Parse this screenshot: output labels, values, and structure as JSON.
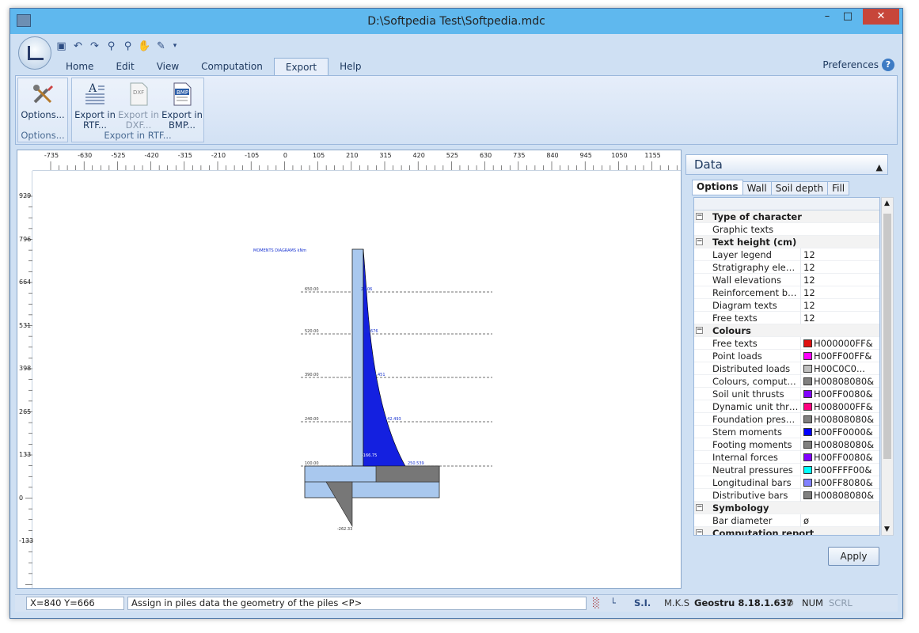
{
  "window": {
    "title": "D:\\Softpedia Test\\Softpedia.mdc",
    "min": "–",
    "max": "□",
    "close": "✕"
  },
  "menu": {
    "tabs": [
      "Home",
      "Edit",
      "View",
      "Computation",
      "Export",
      "Help"
    ],
    "active": "Export",
    "preferences": "Preferences",
    "help_icon": "?"
  },
  "ribbon": {
    "options_button": "Options...",
    "options_group": "Options...",
    "export_rtf": "Export in RTF...",
    "export_dxf": "Export in DXF...",
    "export_bmp": "Export in BMP...",
    "export_group": "Export in RTF..."
  },
  "ruler": {
    "h_ticks": [
      "-735",
      "-630",
      "-525",
      "-420",
      "-315",
      "-210",
      "-105",
      "0",
      "105",
      "210",
      "315",
      "420",
      "525",
      "630",
      "735",
      "840",
      "945",
      "1050",
      "1155"
    ],
    "v_ticks": [
      "929",
      "796",
      "664",
      "531",
      "398",
      "265",
      "133",
      "0",
      "-133"
    ]
  },
  "drawing": {
    "title": "MOMENTS DIAGRAMS kNm",
    "levels": [
      "650.00",
      "520.00",
      "390.00",
      "240.00",
      "100.00"
    ],
    "values": [
      "2.506",
      "17.676",
      "60.451",
      "142.493",
      "250.539",
      "-166.75",
      "-262.33"
    ]
  },
  "panel": {
    "title": "Data",
    "tabs": [
      "Options",
      "Wall",
      "Soil depth",
      "Fill"
    ],
    "active_tab": "Options",
    "rows": [
      {
        "type": "cat",
        "label": "Type of character"
      },
      {
        "type": "item",
        "label": "Graphic texts",
        "value": ""
      },
      {
        "type": "cat",
        "label": "Text height (cm)"
      },
      {
        "type": "item",
        "label": "Layer legend",
        "value": "12"
      },
      {
        "type": "item",
        "label": "Stratigraphy elevati...",
        "value": "12"
      },
      {
        "type": "item",
        "label": "Wall elevations",
        "value": "12"
      },
      {
        "type": "item",
        "label": "Reinforcement bars...",
        "value": "12"
      },
      {
        "type": "item",
        "label": "Diagram texts",
        "value": "12"
      },
      {
        "type": "item",
        "label": "Free texts",
        "value": "12"
      },
      {
        "type": "cat",
        "label": "Colours"
      },
      {
        "type": "item",
        "label": "Free texts",
        "value": "H000000FF&",
        "color": "#e01010"
      },
      {
        "type": "item",
        "label": "Point loads",
        "value": "H00FF00FF&",
        "color": "#ff00ff"
      },
      {
        "type": "item",
        "label": "Distributed loads",
        "value": "H00C0C0...",
        "color": "#c0c0c0"
      },
      {
        "type": "item",
        "label": "Colours, computatio...",
        "value": "H00808080&",
        "color": "#808080"
      },
      {
        "type": "item",
        "label": "Soil unit thrusts",
        "value": "H00FF0080&",
        "color": "#8000ff"
      },
      {
        "type": "item",
        "label": "Dynamic unit thrusts",
        "value": "H008000FF&",
        "color": "#ff0080"
      },
      {
        "type": "item",
        "label": "Foundation pressures",
        "value": "H00808080&",
        "color": "#808080"
      },
      {
        "type": "item",
        "label": "Stem moments",
        "value": "H00FF0000&",
        "color": "#0000ff"
      },
      {
        "type": "item",
        "label": "Footing moments",
        "value": "H00808080&",
        "color": "#808080"
      },
      {
        "type": "item",
        "label": "Internal forces",
        "value": "H00FF0080&",
        "color": "#8000ff"
      },
      {
        "type": "item",
        "label": "Neutral pressures",
        "value": "H00FFFF00&",
        "color": "#00ffff"
      },
      {
        "type": "item",
        "label": "Longitudinal bars",
        "value": "H00FF8080&",
        "color": "#8080ff"
      },
      {
        "type": "item",
        "label": "Distributive bars",
        "value": "H00808080&",
        "color": "#808080"
      },
      {
        "type": "cat",
        "label": "Symbology"
      },
      {
        "type": "item",
        "label": "Bar diameter",
        "value": "ø"
      },
      {
        "type": "cat",
        "label": "Computation report"
      }
    ],
    "apply": "Apply"
  },
  "status": {
    "coords": "X=840  Y=666",
    "hint": "Assign in piles data the geometry of the piles <P>",
    "units1": "S.I.",
    "units2": "M.K.S",
    "version": "Geostru 8.18.1.637",
    "num": "NUM",
    "scrl": "SCRL"
  }
}
